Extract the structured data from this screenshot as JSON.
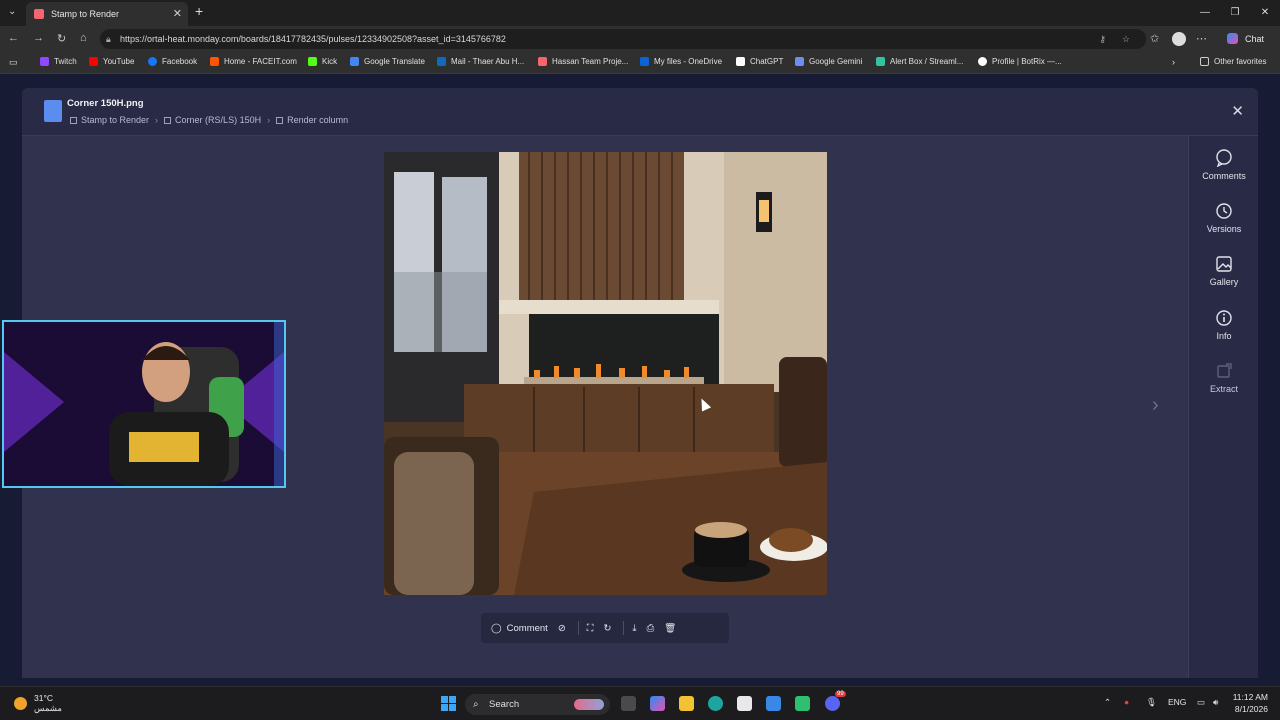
{
  "browser": {
    "tab_title": "Stamp to Render",
    "url": "https://ortal-heat.monday.com/boards/18417782435/pulses/12334902508?asset_id=3145766782",
    "chat_label": "Chat",
    "bookmarks": [
      "Twitch",
      "YouTube",
      "Facebook",
      "Home - FACEIT.com",
      "Kick",
      "Google Translate",
      "Mail - Thaer Abu H...",
      "Hassan Team Proje...",
      "My files - OneDrive",
      "ChatGPT",
      "Google Gemini",
      "Alert Box / Streaml...",
      "Profile | BotRix —..."
    ],
    "other_favorites": "Other favorites"
  },
  "modal": {
    "file_name": "Corner 150H.png",
    "breadcrumbs": [
      "Stamp to Render",
      "Corner (RS/LS) 150H",
      "Render column"
    ]
  },
  "toolbar": {
    "comment_label": "Comment"
  },
  "sidebar": {
    "items": [
      {
        "label": "Comments",
        "icon": "comment-icon"
      },
      {
        "label": "Versions",
        "icon": "history-icon"
      },
      {
        "label": "Gallery",
        "icon": "gallery-icon"
      },
      {
        "label": "Info",
        "icon": "info-icon"
      },
      {
        "label": "Extract",
        "icon": "extract-icon"
      }
    ]
  },
  "taskbar": {
    "temperature": "31°C",
    "weather_text": "مشمس",
    "search_label": "Search",
    "language": "ENG",
    "time": "11:12 AM",
    "date": "8/1/2026",
    "discord_badge": "99"
  },
  "colors": {
    "page_bg": "#181b34",
    "modal_bg": "#30324e",
    "accent_blue": "#5b8def"
  }
}
